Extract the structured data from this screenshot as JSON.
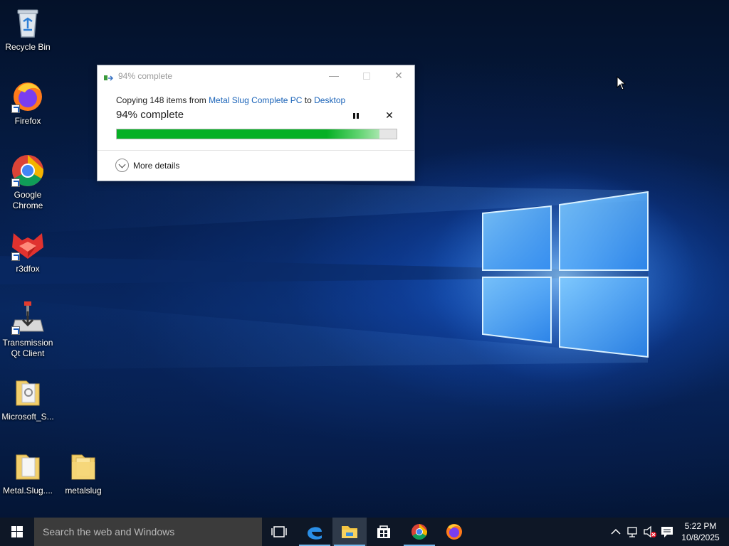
{
  "desktop": {
    "icons": [
      {
        "label": "Recycle Bin"
      },
      {
        "label": "Firefox"
      },
      {
        "label": "Google Chrome"
      },
      {
        "label": "r3dfox"
      },
      {
        "label": "Transmission Qt Client"
      },
      {
        "label": "Microsoft_S..."
      },
      {
        "label": "Metal.Slug...."
      },
      {
        "label": "metalslug"
      }
    ]
  },
  "copy_dialog": {
    "title": "94% complete",
    "copy_prefix": "Copying 148 items from ",
    "source": "Metal Slug Complete PC",
    "to_word": " to ",
    "destination": "Desktop",
    "percent_text": "94% complete",
    "progress": 0.94,
    "more_details_label": "More details",
    "icons": {
      "minimize": "minimize-icon",
      "maximize": "maximize-icon",
      "close": "close-icon",
      "pause": "pause-icon",
      "cancel": "cancel-icon"
    },
    "colors": {
      "progress": "#06b025",
      "link": "#1a63b8"
    }
  },
  "taskbar": {
    "search_placeholder": "Search the web and Windows",
    "pinned": [
      {
        "name": "task-view",
        "icon": "task-view-icon"
      },
      {
        "name": "edge",
        "icon": "edge-icon"
      },
      {
        "name": "file-explorer",
        "icon": "file-explorer-icon",
        "active": true
      },
      {
        "name": "store",
        "icon": "store-icon"
      },
      {
        "name": "chrome",
        "icon": "chrome-icon"
      },
      {
        "name": "firefox",
        "icon": "firefox-icon"
      }
    ],
    "tray": {
      "icons": [
        "chevron-up-icon",
        "network-icon",
        "volume-muted-icon",
        "action-center-icon"
      ]
    },
    "time": "5:22 PM",
    "date": "10/8/2025"
  }
}
